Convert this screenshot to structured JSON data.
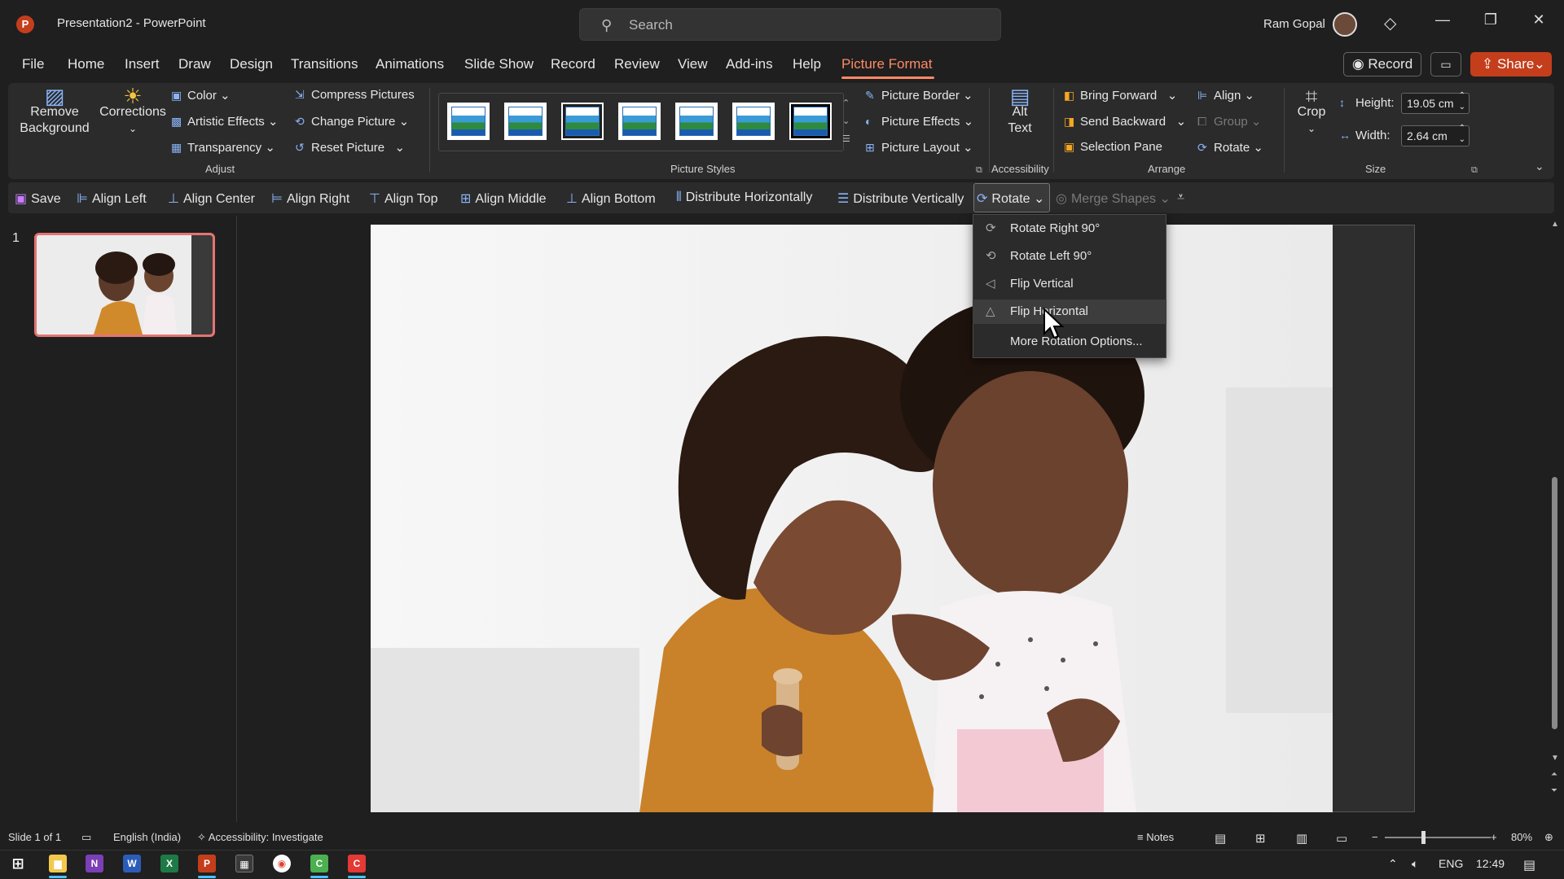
{
  "titlebar": {
    "doc_title": "Presentation2  -  PowerPoint",
    "app_icon": "P",
    "search_placeholder": "Search",
    "user_name": "Ram Gopal"
  },
  "tabs": [
    "File",
    "Home",
    "Insert",
    "Draw",
    "Design",
    "Transitions",
    "Animations",
    "Slide Show",
    "Record",
    "Review",
    "View",
    "Add-ins",
    "Help",
    "Picture Format"
  ],
  "active_tab": "Picture Format",
  "header_buttons": {
    "record": "Record",
    "share": "Share"
  },
  "ribbon": {
    "remove_background": "Remove Background",
    "corrections": "Corrections",
    "color": "Color",
    "artistic_effects": "Artistic Effects",
    "transparency": "Transparency",
    "compress": "Compress Pictures",
    "change_picture": "Change Picture",
    "reset_picture": "Reset Picture",
    "adjust_group": "Adjust",
    "picture_styles_group": "Picture Styles",
    "picture_border": "Picture Border",
    "picture_effects": "Picture Effects",
    "picture_layout": "Picture Layout",
    "alt_text": "Alt Text",
    "accessibility_group": "Accessibility",
    "bring_forward": "Bring Forward",
    "send_backward": "Send Backward",
    "selection_pane": "Selection Pane",
    "align": "Align",
    "group": "Group",
    "rotate": "Rotate",
    "arrange_group": "Arrange",
    "crop": "Crop",
    "height_label": "Height:",
    "height_value": "19.05 cm",
    "width_label": "Width:",
    "width_value": "2.64 cm",
    "size_group": "Size"
  },
  "qat": {
    "save": "Save",
    "align_left": "Align Left",
    "align_center": "Align Center",
    "align_right": "Align Right",
    "align_top": "Align Top",
    "align_middle": "Align Middle",
    "align_bottom": "Align Bottom",
    "distribute_h": "Distribute Horizontally",
    "distribute_v": "Distribute Vertically",
    "rotate": "Rotate",
    "merge_shapes": "Merge Shapes"
  },
  "rotate_menu": [
    {
      "label": "Rotate Right 90°",
      "icon": "rotate-right-icon"
    },
    {
      "label": "Rotate Left 90°",
      "icon": "rotate-left-icon"
    },
    {
      "label": "Flip Vertical",
      "icon": "flip-vertical-icon"
    },
    {
      "label": "Flip Horizontal",
      "icon": "flip-horizontal-icon"
    },
    {
      "label": "More Rotation Options...",
      "icon": ""
    }
  ],
  "hovered_menu_item": "Flip Horizontal",
  "slides": {
    "current_number": "1"
  },
  "status": {
    "slide": "Slide 1 of 1",
    "language": "English (India)",
    "accessibility": "Accessibility: Investigate",
    "notes": "Notes",
    "zoom": "80%"
  },
  "taskbar": {
    "lang": "ENG",
    "time": "12:49"
  },
  "colors": {
    "accent": "#ff8a65",
    "brand": "#c43e1c",
    "ribbon_icon": "#8ab4f8"
  }
}
